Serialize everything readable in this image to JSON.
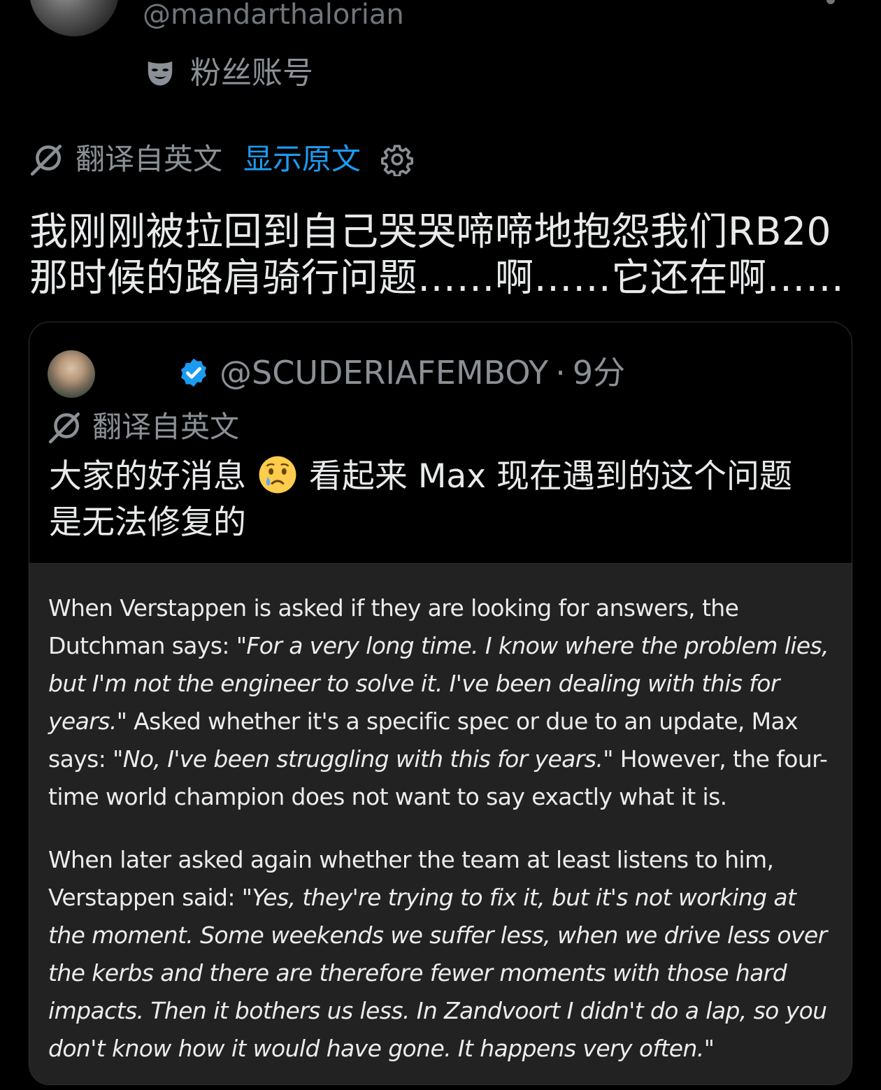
{
  "author": {
    "handle": "@mandarthalorian",
    "badge_label": "粉丝账号"
  },
  "translation_bar": {
    "translated_label": "翻译自英文",
    "show_original_label": "显示原文"
  },
  "tweet": {
    "line1": "我刚刚被拉回到自己哭哭啼啼地抱怨我们RB20",
    "line2": "那时候的路肩骑行问题……啊……它还在啊……"
  },
  "quoted": {
    "handle": "@SCUDERIAFEMBOY",
    "separator": "·",
    "time": "9分",
    "translated_label": "翻译自英文",
    "text_before_emoji": "大家的好消息",
    "text_after_emoji": "看起来 Max 现在遇到的这个问题",
    "text_line2": "是无法修复的",
    "emoji_name": "sad-relieved-face-emoji",
    "article": {
      "p1_plain1": "When Verstappen is asked if they are looking for answers, the Dutchman says: ",
      "p1_quote1": "\"For a very long time. I know where the problem lies, but I'm not the engineer to solve it. I've been dealing with this for years.\"",
      "p1_plain2": " Asked whether it's a specific spec or due to an update, Max says: ",
      "p1_quote2": "\"No, I've been struggling with this for years.\"",
      "p1_plain3": " However, the four-time world champion does not want to say exactly what it is.",
      "p2_plain1": "When later asked again whether the team at least listens to him, Verstappen said: ",
      "p2_quote1": "\"Yes, they're trying to fix it, but it's not working at the moment. Some weekends we suffer less, when we drive less over the kerbs and there are therefore fewer moments with those hard impacts. Then it bothers us less. In Zandvoort I didn't do a lap, so you don't know how it would have gone. It happens very often.\""
    }
  },
  "colors": {
    "background": "#000000",
    "text": "#e7e9ea",
    "muted": "#8b9096",
    "link": "#1d9bf0",
    "verified": "#1d9bf0",
    "article_bg": "#222222"
  }
}
